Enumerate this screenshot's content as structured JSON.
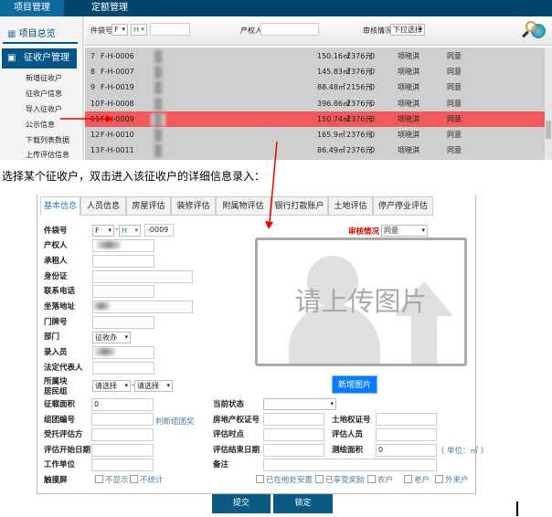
{
  "nav": {
    "tabs": [
      {
        "label": "项目管理",
        "active": true
      },
      {
        "label": "定额管理"
      }
    ]
  },
  "sidebar": {
    "overview": "项目总览",
    "section": "征收户管理",
    "items": [
      "新增征收户",
      "征收户信息",
      "导入征收户",
      "公示信息",
      "下载列表数据",
      "上传评估信息"
    ]
  },
  "toolbar": {
    "file_label": "件袋号",
    "f_value": "F",
    "h_value": "H",
    "owner_label": "产权人",
    "review_label": "审核情况",
    "review_value": "下拉选择",
    "search_icon": "magnifier-globe-icon"
  },
  "table": {
    "rows": [
      {
        "no": "7",
        "code": "F-H-0006",
        "area": "150.16㎡",
        "price": "2376元",
        "count": "0",
        "person": "项晓淇",
        "status": "同意"
      },
      {
        "no": "8",
        "code": "F-H-0007",
        "area": "145.83㎡",
        "price": "2376元",
        "count": "0",
        "person": "项晓淇",
        "status": "同意"
      },
      {
        "no": "9",
        "code": "F-H-0019",
        "area": "88.48㎡",
        "price": "2156元",
        "count": "0",
        "person": "项晓淇",
        "status": "同意"
      },
      {
        "no": "10",
        "code": "F-H-0008",
        "area": "396.86㎡",
        "price": "2376元",
        "count": "0",
        "person": "项晓淇",
        "status": "同意"
      },
      {
        "no": "11",
        "code": "F-H-0009",
        "area": "150.74㎡",
        "price": "2376元",
        "count": "0",
        "person": "项晓淇",
        "status": "同意",
        "selected": true
      },
      {
        "no": "12",
        "code": "F-H-0010",
        "area": "165.9㎡",
        "price": "2376元",
        "count": "0",
        "person": "项晓淇",
        "status": "同意"
      },
      {
        "no": "13",
        "code": "F-H-0011",
        "area": "86.49㎡",
        "price": "2376元",
        "count": "0",
        "person": "项晓淇",
        "status": "同意"
      }
    ],
    "highlight_color": "#f15a5a"
  },
  "caption": "选择某个征收户，双击进入该征收户的详细信息录入：",
  "form": {
    "tabs": [
      "基本信息",
      "人员信息",
      "房屋评估",
      "装修评估",
      "附属物评估",
      "银行打款账户",
      "土地评估",
      "停产停业评估"
    ],
    "labels": {
      "file": "件袋号",
      "owner": "产权人",
      "tenant": "承租人",
      "id": "身份证",
      "phone": "联系电话",
      "address": "坐落地址",
      "door": "门牌号",
      "dept": "部门",
      "entry": "录入员",
      "legal": "法定代表人",
      "block": "所属块",
      "group": "居民组",
      "area": "征载面积",
      "team": "组团编号",
      "client": "受托评估方",
      "start": "评估开始日期",
      "work": "工作单位",
      "touch": "触摸屏",
      "state": "当前状态",
      "deed": "房地产权证号",
      "land": "土地权证号",
      "time": "评估时点",
      "assessor": "评估人员",
      "end": "评估结束日期",
      "survey": "测绘面积",
      "note": "备注",
      "review": "审核情况"
    },
    "values": {
      "f": "F",
      "h": "H",
      "file_suffix": "-0009",
      "dept": "征收办",
      "block": "请选择",
      "group": "请选择",
      "area": "0",
      "survey": "0",
      "review": "同意"
    },
    "team_hint": "判断组团奖",
    "unit": "( 单位：㎡ )",
    "upload_text": "请上传图片",
    "add_image": "新增图片",
    "checkboxes_left": [
      "不显示",
      "不统计"
    ],
    "checkboxes_right": [
      "已在他处安置",
      "已享受奖励",
      "农户",
      "老户",
      "外来户"
    ],
    "submit": "提交",
    "lock": "锁定"
  },
  "colors": {
    "nav": "#00456e",
    "accent": "#00558a",
    "button": "#0a5a85",
    "add_image": "#0a7cff",
    "review_label": "#e00000"
  }
}
